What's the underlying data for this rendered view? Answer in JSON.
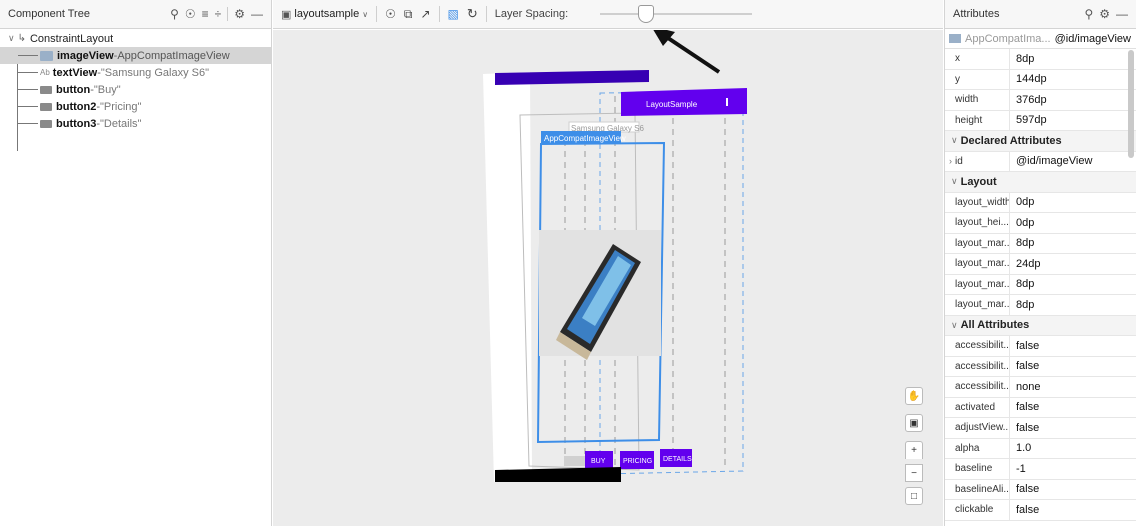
{
  "tree_panel": {
    "title": "Component Tree",
    "root_label": "ConstraintLayout",
    "items": [
      {
        "name": "imageView",
        "sep": " - ",
        "type": "AppCompatImageView"
      },
      {
        "name": "textView",
        "sep": " - ",
        "type": "\"Samsung Galaxy S6\""
      },
      {
        "name": "button",
        "sep": " - ",
        "type": "\"Buy\""
      },
      {
        "name": "button2",
        "sep": " - ",
        "type": "\"Pricing\""
      },
      {
        "name": "button3",
        "sep": " - ",
        "type": "\"Details\""
      }
    ],
    "text_icon_label": "Ab"
  },
  "toolbar": {
    "layout_select": "layoutsample",
    "layer_spacing_label": "Layer Spacing:"
  },
  "canvas": {
    "top_bar_title": "LayoutSample",
    "textview_text": "Samsung Galaxy S6",
    "image_label": "AppCompatImageView",
    "buttons": [
      "BUY",
      "PRICING",
      "DETAILS"
    ],
    "colors": {
      "accent_purple": "#6200ee",
      "dark_purple": "#3700b3",
      "selection_blue": "#3d8ee8"
    }
  },
  "attributes": {
    "title": "Attributes",
    "summary_type": "AppCompatIma...",
    "summary_id": "@id/imageView",
    "basic": [
      {
        "key": "x",
        "value": "8dp"
      },
      {
        "key": "y",
        "value": "144dp"
      },
      {
        "key": "width",
        "value": "376dp"
      },
      {
        "key": "height",
        "value": "597dp"
      }
    ],
    "declared_title": "Declared Attributes",
    "declared": [
      {
        "key": "id",
        "value": "@id/imageView"
      }
    ],
    "layout_title": "Layout",
    "layout": [
      {
        "key": "layout_width",
        "value": "0dp"
      },
      {
        "key": "layout_hei...",
        "value": "0dp"
      },
      {
        "key": "layout_mar...",
        "value": "8dp"
      },
      {
        "key": "layout_mar...",
        "value": "24dp"
      },
      {
        "key": "layout_mar...",
        "value": "8dp"
      },
      {
        "key": "layout_mar...",
        "value": "8dp"
      }
    ],
    "all_title": "All Attributes",
    "all": [
      {
        "key": "accessibilit...",
        "value": "false"
      },
      {
        "key": "accessibilit...",
        "value": "false"
      },
      {
        "key": "accessibilit...",
        "value": "none"
      },
      {
        "key": "activated",
        "value": "false"
      },
      {
        "key": "adjustView...",
        "value": "false"
      },
      {
        "key": "alpha",
        "value": "1.0"
      },
      {
        "key": "baseline",
        "value": "-1"
      },
      {
        "key": "baselineAli...",
        "value": "false"
      },
      {
        "key": "clickable",
        "value": "false"
      }
    ]
  }
}
